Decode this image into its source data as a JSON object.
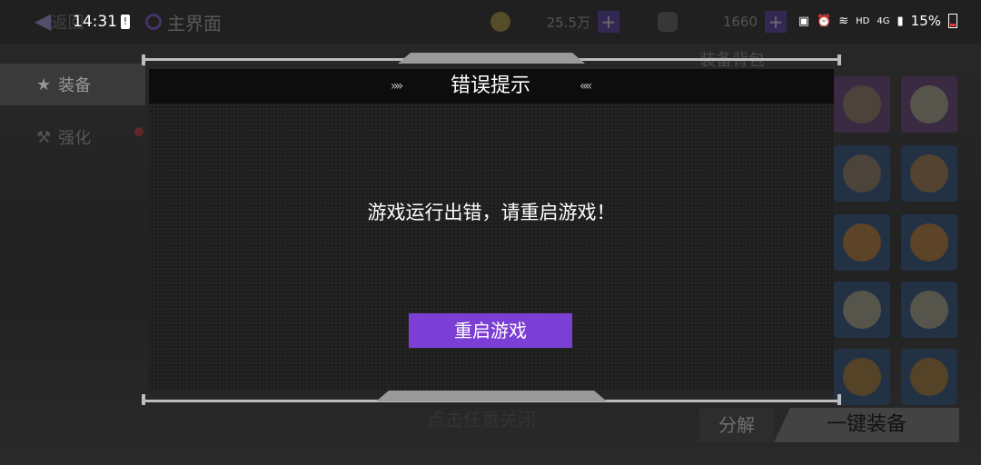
{
  "status_bar": {
    "time": "14:31",
    "alert_glyph": "!",
    "network_hd": "HD",
    "network_type": "4G",
    "battery": "15%"
  },
  "game": {
    "back_label": "返回",
    "home_tab": "主界面",
    "currency_1": "25.5万",
    "currency_2": "1660",
    "plus": "+",
    "sidebar": [
      {
        "label": "装备",
        "icon": "star-icon",
        "active": true
      },
      {
        "label": "强化",
        "icon": "hammer-icon",
        "active": false
      }
    ],
    "bag_title": "装备背包",
    "bottom_hint": "点击任意关闭",
    "decompose_label": "分解",
    "equip_all_label": "一键装备"
  },
  "dialog": {
    "title": "错误提示",
    "left_chevron": "»»",
    "right_chevron": "««",
    "message": "游戏运行出错，请重启游戏！",
    "button": "重启游戏",
    "button_color": "#7b3fd6"
  }
}
